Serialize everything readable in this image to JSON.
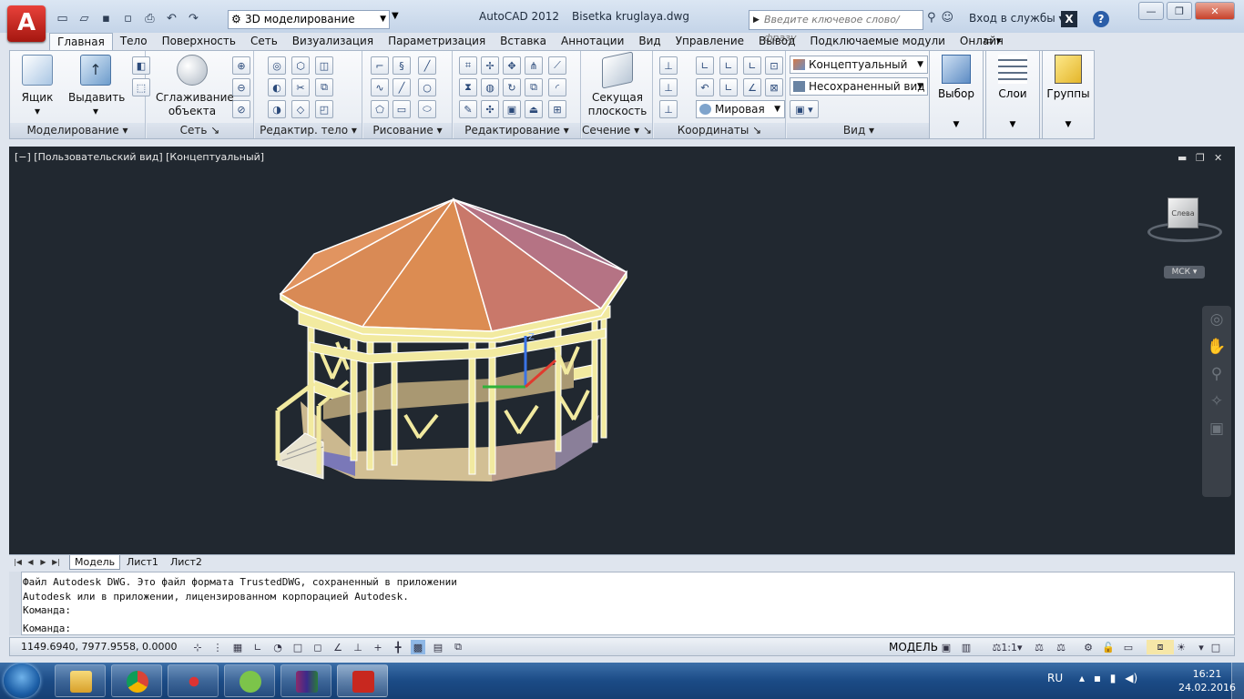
{
  "titlebar": {
    "app_title": "AutoCAD 2012",
    "file_name": "Bisetka kruglaya.dwg",
    "workspace": "3D моделирование",
    "search_placeholder": "Введите ключевое слово/фразу",
    "signin": "Вход в службы"
  },
  "tabs": [
    "Главная",
    "Тело",
    "Поверхность",
    "Сеть",
    "Визуализация",
    "Параметризация",
    "Вставка",
    "Аннотации",
    "Вид",
    "Управление",
    "Вывод",
    "Подключаемые модули",
    "Онлайн"
  ],
  "ribbon": {
    "btn_box": "Ящик",
    "btn_extrude": "Выдавить",
    "btn_smooth": "Сглаживание объекта",
    "btn_section_plane": "Секущая плоскость",
    "panels": {
      "modeling": "Моделирование",
      "mesh": "Сеть",
      "solid_edit": "Редактир. тело",
      "draw": "Рисование",
      "modify": "Редактирование",
      "section": "Сечение",
      "coordinates": "Координаты",
      "view": "Вид"
    },
    "visual_style": "Концептуальный",
    "saved_view": "Несохраненный вид",
    "ucs_combo": "Мировая",
    "selection": "Выбор",
    "layers": "Слои",
    "groups": "Группы"
  },
  "viewport": {
    "label": "[−] [Пользовательский вид] [Концептуальный]",
    "viewcube_face": "Слева",
    "ucs_label": "МСК"
  },
  "layout_tabs": [
    "Модель",
    "Лист1",
    "Лист2"
  ],
  "command": {
    "history": [
      "Файл Autodesk DWG. Это файл формата TrustedDWG, сохраненный в приложении",
      "Autodesk или в приложении, лицензированном корпорацией Autodesk.",
      "Команда:"
    ],
    "prompt": "Команда:"
  },
  "status": {
    "coords": "1149.6940,  7977.9558, 0.0000",
    "model": "МОДЕЛЬ",
    "scale": "1:1"
  },
  "taskbar": {
    "lang": "RU",
    "time": "16:21",
    "date": "24.02.2016"
  },
  "colors": {
    "roof": "#d98a55",
    "frame": "#f2eaa0",
    "wall": "#cbb88f",
    "viewport_bg": "#212830",
    "accent_red": "#c8281f"
  }
}
